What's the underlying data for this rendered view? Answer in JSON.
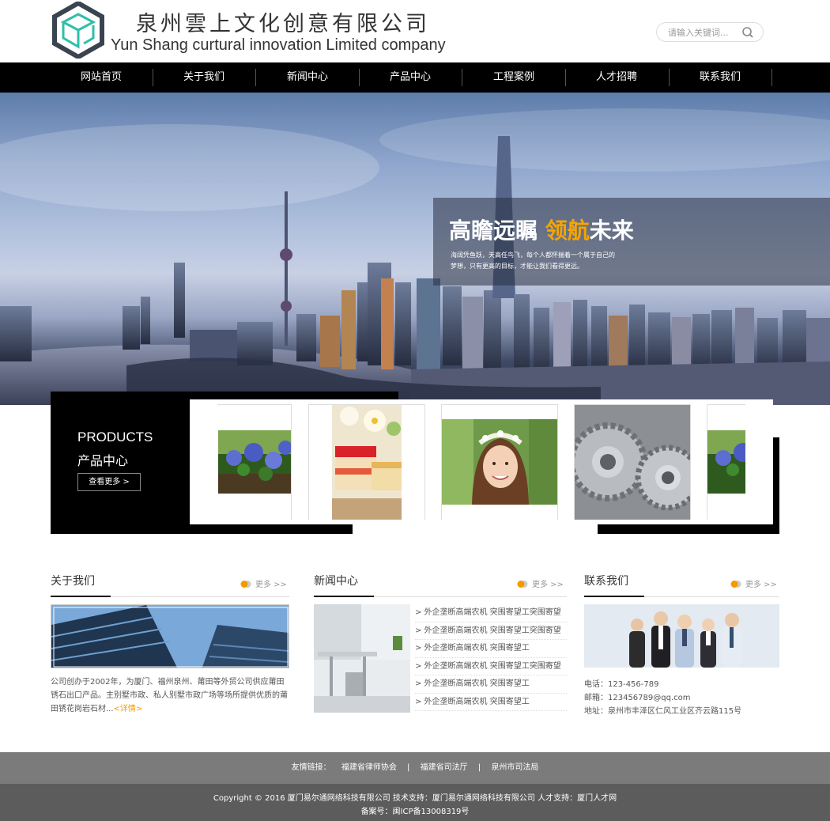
{
  "header": {
    "company_cn": "泉州雲上文化创意有限公司",
    "company_en": "Yun Shang curtural innovation Limited company",
    "search_placeholder": "请输入关键词...",
    "brand_color": "#3a4450",
    "accent_color": "#2fbfa8"
  },
  "nav": {
    "items": [
      {
        "label": "网站首页"
      },
      {
        "label": "关于我们"
      },
      {
        "label": "新闻中心"
      },
      {
        "label": "产品中心"
      },
      {
        "label": "工程案例"
      },
      {
        "label": "人才招聘"
      },
      {
        "label": "联系我们"
      }
    ]
  },
  "banner": {
    "title_a": "高瞻远瞩",
    "title_b": "领航",
    "title_c": "未来",
    "desc": "海阔凭鱼跃，天高任鸟飞，每个人都怀揣着一个属于自己的梦想，只有更高的目标，才能让我们看得更远。"
  },
  "products": {
    "title_en": "PRODUCTS",
    "title_cn": "产品中心",
    "more_label": "查看更多 >",
    "items": [
      {
        "image": "hydrangea-garden"
      },
      {
        "image": "cake-dessert"
      },
      {
        "image": "smiling-girl-portrait"
      },
      {
        "image": "steel-gears"
      },
      {
        "image": "hydrangea-garden"
      }
    ]
  },
  "about": {
    "title": "关于我们",
    "more": "更多 >>",
    "text": "公司创办于2002年，为厦门、福州泉州、莆田等外贸公司供应莆田锈石出口产品。主别墅市政、私人别墅市政广场等场所提供优质的莆田锈花岗岩石材...",
    "detail_link": "<详情>"
  },
  "news": {
    "title": "新闻中心",
    "more": "更多 >>",
    "items": [
      "> 外企垄断高端农机 突围寄望工突围寄望",
      "> 外企垄断高端农机 突围寄望工突围寄望",
      "> 外企垄断高端农机 突围寄望工",
      "> 外企垄断高端农机 突围寄望工突围寄望",
      "> 外企垄断高端农机 突围寄望工",
      "> 外企垄断高端农机 突围寄望工"
    ]
  },
  "contact": {
    "title": "联系我们",
    "more": "更多 >>",
    "phone": "电话：123-456-789",
    "email": "邮箱：123456789@qq.com",
    "address": "地址：泉州市丰泽区仁风工业区齐云路115号"
  },
  "footer": {
    "links_label": "友情链接：",
    "links": [
      "福建省律师协会",
      "福建省司法厅",
      "泉州市司法局"
    ],
    "separator": "|",
    "copyright": "Copyright © 2016 厦门易尔通网络科技有限公司 技术支持：厦门易尔通网络科技有限公司 人才支持：厦门人才网",
    "icp": "备案号：闽ICP备13008319号"
  }
}
